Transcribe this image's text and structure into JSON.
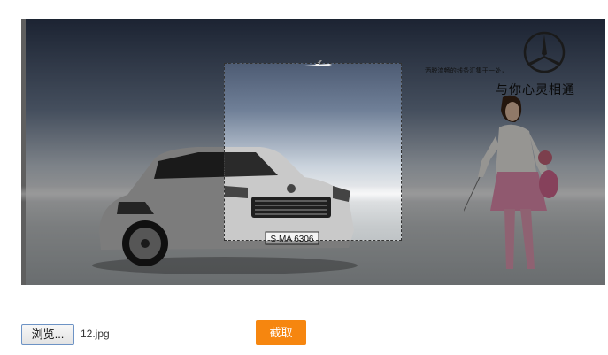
{
  "image": {
    "tagline_small": "洒脱流畅的线条汇集于一处，",
    "tagline_big": "与你心灵相通",
    "license_plate": "S MA 6306"
  },
  "controls": {
    "browse_label": "浏览...",
    "file_name": "12.jpg",
    "crop_label": "截取"
  }
}
